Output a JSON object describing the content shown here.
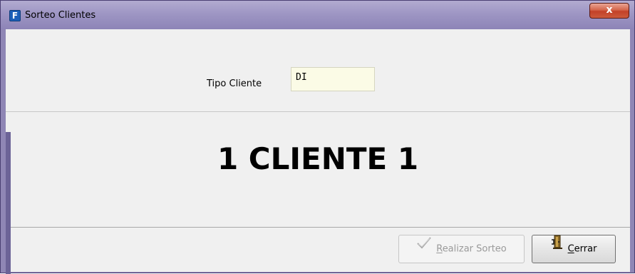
{
  "window": {
    "title": "Sorteo Clientes",
    "app_icon_glyph": "F",
    "close_glyph": "x"
  },
  "form": {
    "tipo_cliente_label": "Tipo Cliente",
    "tipo_cliente_value": "DI"
  },
  "result": {
    "text": "1 CLIENTE 1"
  },
  "buttons": {
    "sorteo": {
      "mnemonic": "R",
      "rest": "ealizar Sorteo",
      "enabled": false,
      "icon": "checkmark-icon"
    },
    "cerrar": {
      "mnemonic": "C",
      "rest": "errar",
      "enabled": true,
      "icon": "door-exit-icon"
    }
  },
  "colors": {
    "titlebar": "#9e96c4",
    "input_bg": "#fbfbe6",
    "close_button": "#c24128",
    "disabled_text": "#9a9a9a"
  }
}
